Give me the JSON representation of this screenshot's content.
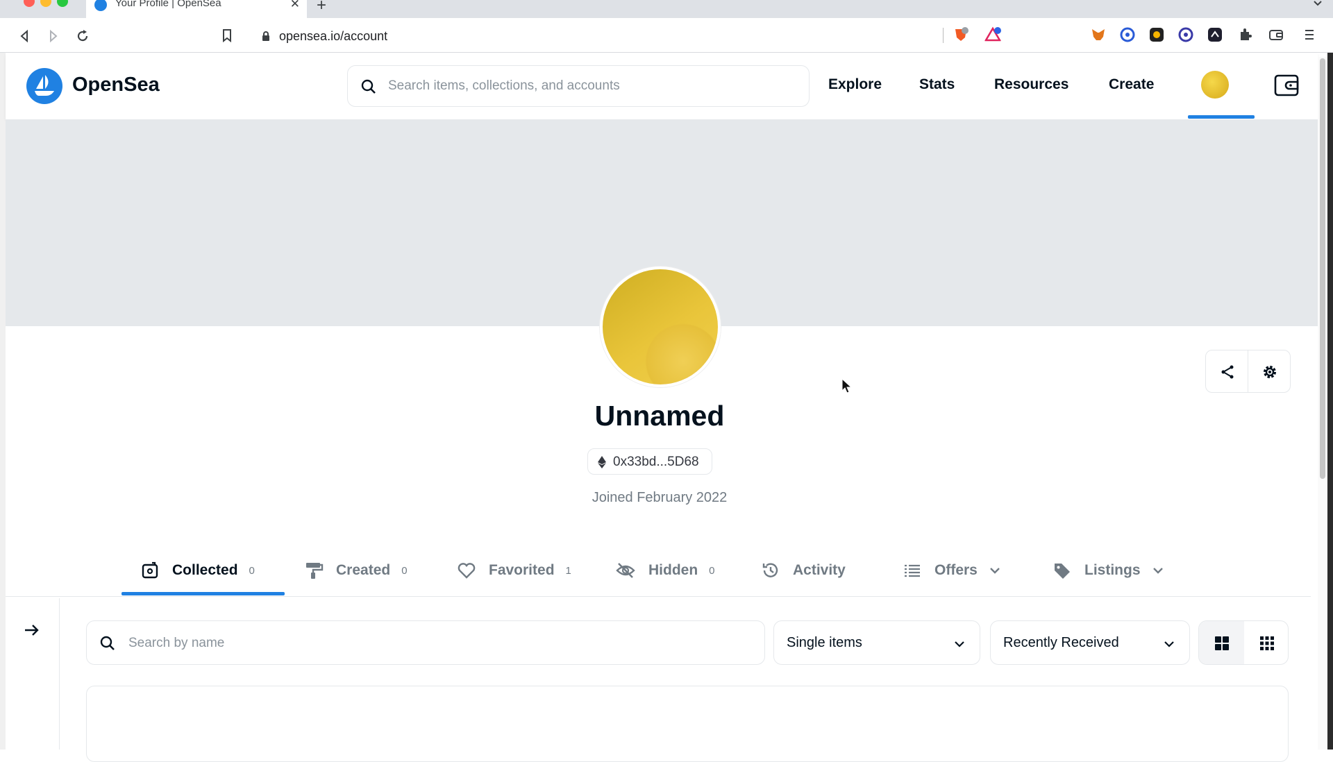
{
  "browser": {
    "tab_title": "Your Profile | OpenSea",
    "tab_close": "✕",
    "new_tab": "+",
    "url": "opensea.io/account",
    "traffic_lights": [
      "#ff5f57",
      "#febc2e",
      "#28c840"
    ]
  },
  "header": {
    "brand": "OpenSea",
    "search_placeholder": "Search items, collections, and accounts",
    "nav": [
      "Explore",
      "Stats",
      "Resources",
      "Create"
    ],
    "accent_color": "#2081e2"
  },
  "profile": {
    "name": "Unnamed",
    "address": "0x33bd...5D68",
    "joined": "Joined February 2022"
  },
  "tabs": [
    {
      "label": "Collected",
      "count": "0",
      "icon": "collected-icon"
    },
    {
      "label": "Created",
      "count": "0",
      "icon": "paint-roller-icon"
    },
    {
      "label": "Favorited",
      "count": "1",
      "icon": "heart-icon"
    },
    {
      "label": "Hidden",
      "count": "0",
      "icon": "eye-off-icon"
    },
    {
      "label": "Activity",
      "icon": "history-icon"
    },
    {
      "label": "Offers",
      "icon": "list-icon"
    },
    {
      "label": "Listings",
      "icon": "tag-icon"
    }
  ],
  "filters": {
    "search_placeholder": "Search by name",
    "item_type": "Single items",
    "sort": "Recently Received"
  }
}
